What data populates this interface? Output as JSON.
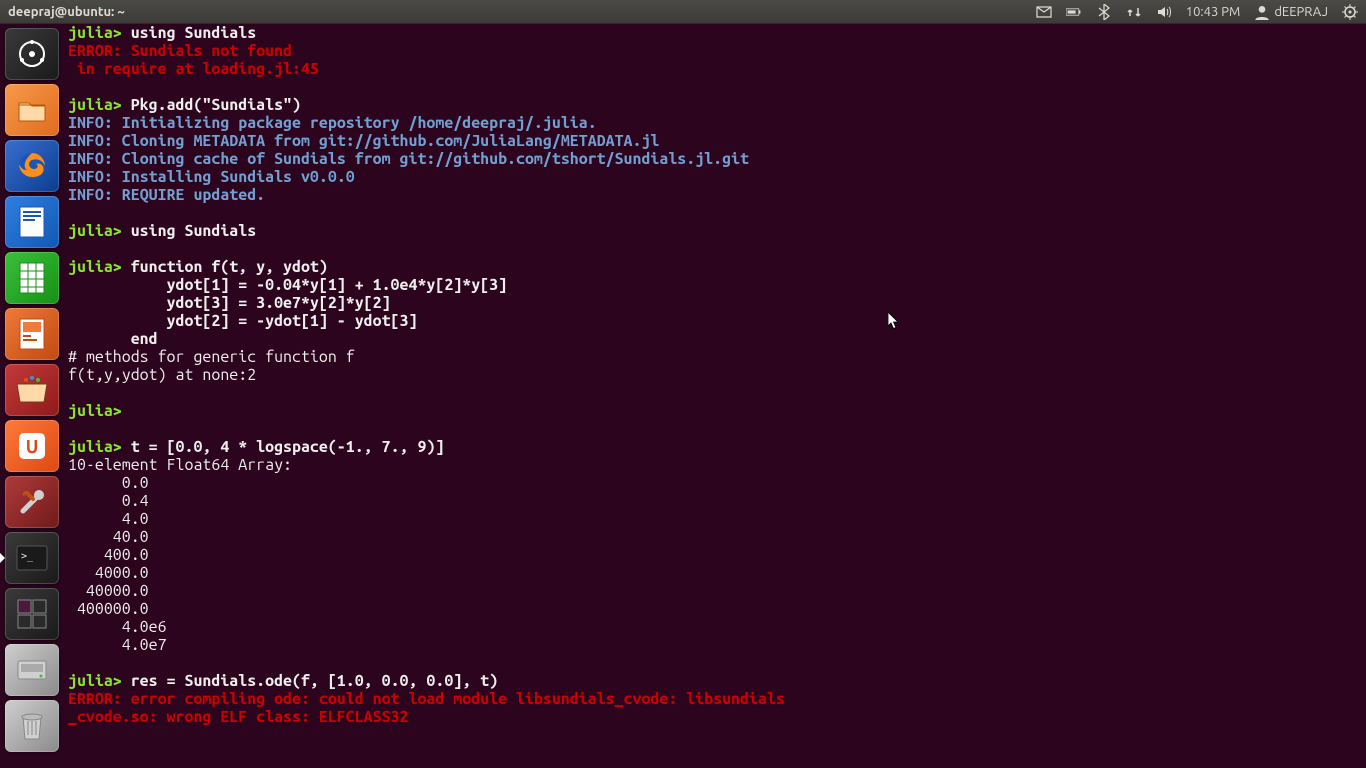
{
  "panel": {
    "title": "deepraj@ubuntu: ~",
    "time": "10:43 PM",
    "user": "dEEPRAJ"
  },
  "prompt": "julia>",
  "lines": {
    "l1_cmd": " using Sundials",
    "l2_err": "ERROR: Sundials not found",
    "l3_err": " in require at loading.jl:45",
    "l4_cmd": " Pkg.add(\"Sundials\")",
    "l5_tag": "INFO:",
    "l5_txt": " Initializing package repository /home/deepraj/.julia.",
    "l6_tag": "INFO:",
    "l6_txt": " Cloning METADATA from git://github.com/JuliaLang/METADATA.jl",
    "l7_tag": "INFO:",
    "l7_txt": " Cloning cache of Sundials from git://github.com/tshort/Sundials.jl.git",
    "l8_tag": "INFO:",
    "l8_txt": " Installing Sundials v0.0.0",
    "l9_tag": "INFO:",
    "l9_txt": " REQUIRE updated.",
    "l10_cmd": " using Sundials",
    "l11_cmd": " function f(t, y, ydot)",
    "l12": "           ydot[1] = -0.04*y[1] + 1.0e4*y[2]*y[3]",
    "l13": "           ydot[3] = 3.0e7*y[2]*y[2]",
    "l14": "           ydot[2] = -ydot[1] - ydot[3]",
    "l15": "       end",
    "l16": "# methods for generic function f",
    "l17": "f(t,y,ydot) at none:2",
    "l18_cmd": " t = [0.0, 4 * logspace(-1., 7., 9)]",
    "l19": "10-element Float64 Array:",
    "a0": "      0.0 ",
    "a1": "      0.4 ",
    "a2": "      4.0 ",
    "a3": "     40.0 ",
    "a4": "    400.0 ",
    "a5": "   4000.0 ",
    "a6": "  40000.0 ",
    "a7": " 400000.0 ",
    "a8": "      4.0e6",
    "a9": "      4.0e7",
    "l20_cmd": " res = Sundials.ode(f, [1.0, 0.0, 0.0], t)",
    "l21_err": "ERROR: error compiling ode: could not load module libsundials_cvode: libsundials",
    "l22_err": "_cvode.so: wrong ELF class: ELFCLASS32"
  },
  "launcher": [
    {
      "name": "dash",
      "bg": "linear-gradient(135deg,#3a3a3a,#1a1a1a)"
    },
    {
      "name": "files",
      "bg": "linear-gradient(135deg,#f79a4a,#e06b1f)"
    },
    {
      "name": "firefox",
      "bg": "linear-gradient(135deg,#3a6ed0,#0a3d8f)"
    },
    {
      "name": "writer",
      "bg": "linear-gradient(135deg,#2f7fe0,#1258b5)"
    },
    {
      "name": "calc",
      "bg": "linear-gradient(135deg,#3bc13b,#159015)"
    },
    {
      "name": "impress",
      "bg": "linear-gradient(135deg,#f07a3a,#c04a10)"
    },
    {
      "name": "software",
      "bg": "linear-gradient(135deg,#c33a3a,#901a1a)"
    },
    {
      "name": "ubuntu-one",
      "bg": "linear-gradient(135deg,#ff7a3a,#dd4814)"
    },
    {
      "name": "settings",
      "bg": "linear-gradient(135deg,#b03a3a,#701a1a)"
    },
    {
      "name": "terminal",
      "bg": "linear-gradient(135deg,#3a3a3a,#1a1a1a)",
      "active": true
    },
    {
      "name": "workspace",
      "bg": "linear-gradient(135deg,#3a3a3a,#1a1a1a)"
    },
    {
      "name": "disk",
      "bg": "linear-gradient(135deg,#cfcfcf,#8a8a8a)"
    },
    {
      "name": "trash",
      "bg": "linear-gradient(135deg,#cfcfcf,#8a8a8a)"
    }
  ]
}
